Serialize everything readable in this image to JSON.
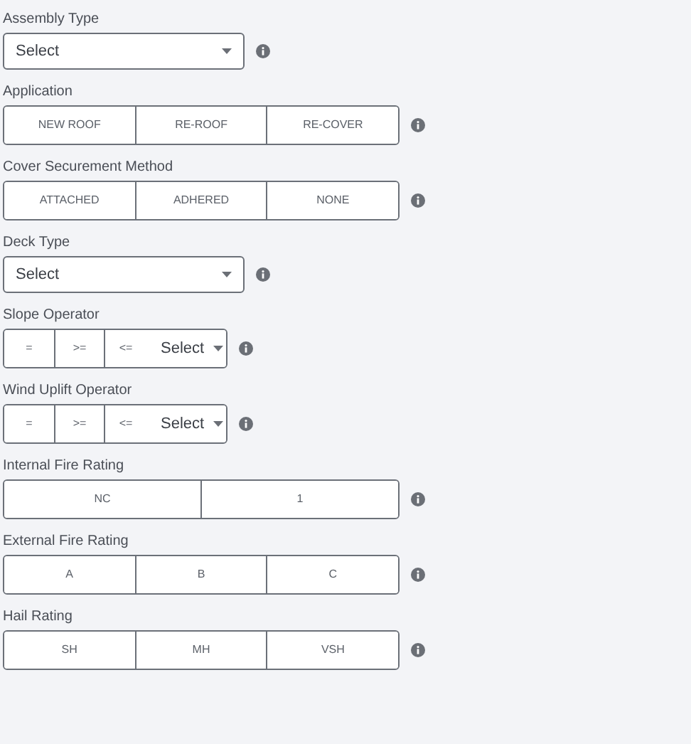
{
  "fields": [
    {
      "kind": "select",
      "label": "Assembly Type",
      "value": "Select"
    },
    {
      "kind": "buttons",
      "label": "Application",
      "options": [
        "NEW ROOF",
        "RE-ROOF",
        "RE-COVER"
      ]
    },
    {
      "kind": "buttons",
      "label": "Cover Securement Method",
      "options": [
        "ATTACHED",
        "ADHERED",
        "NONE"
      ]
    },
    {
      "kind": "select",
      "label": "Deck Type",
      "value": "Select"
    },
    {
      "kind": "operator",
      "label": "Slope Operator",
      "options": [
        "=",
        ">=",
        "<="
      ],
      "value": "Select"
    },
    {
      "kind": "operator",
      "label": "Wind Uplift Operator",
      "options": [
        "=",
        ">=",
        "<="
      ],
      "value": "Select"
    },
    {
      "kind": "buttons",
      "label": "Internal Fire Rating",
      "options": [
        "NC",
        "1"
      ]
    },
    {
      "kind": "buttons",
      "label": "External Fire Rating",
      "options": [
        "A",
        "B",
        "C"
      ]
    },
    {
      "kind": "buttons",
      "label": "Hail Rating",
      "options": [
        "SH",
        "MH",
        "VSH"
      ]
    }
  ]
}
